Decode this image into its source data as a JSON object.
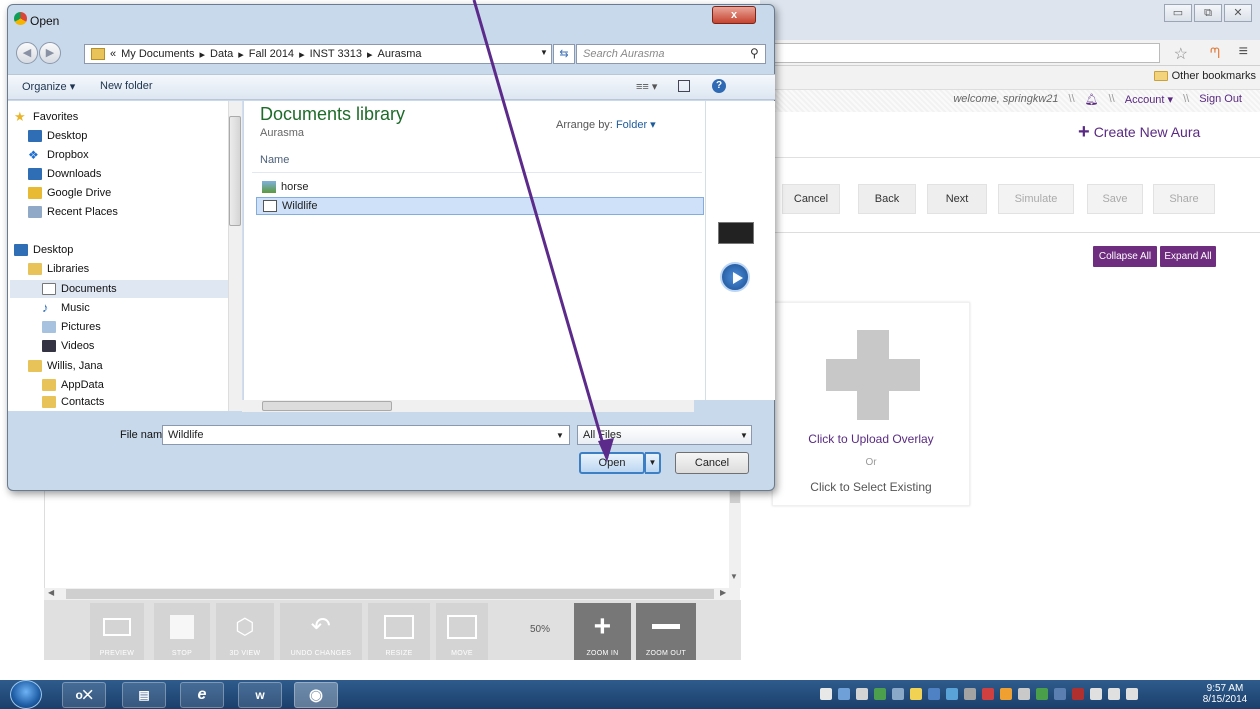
{
  "browser": {
    "win_controls": [
      "▭",
      "⧉",
      "✕"
    ],
    "other_bookmarks": "Other bookmarks"
  },
  "site": {
    "welcome": "welcome, springkw21",
    "sep": "\\\\",
    "account": "Account ▾",
    "signout": "Sign Out",
    "create_aura": "Create New Aura",
    "actions": [
      "Cancel",
      "Back",
      "Next",
      "Simulate",
      "Save",
      "Share"
    ],
    "collapse_all": "Collapse All",
    "expand_all": "Expand All",
    "overlay": {
      "upload": "Click to Upload Overlay",
      "or": "Or",
      "select": "Click to Select Existing"
    },
    "editor_toolbar": {
      "buttons": [
        "PREVIEW",
        "STOP",
        "3D VIEW",
        "UNDO CHANGES",
        "RESIZE",
        "MOVE",
        "ZOOM IN",
        "ZOOM OUT"
      ],
      "zoom_level": "50%"
    }
  },
  "dialog": {
    "title": "Open",
    "close": "x",
    "breadcrumb": [
      "«",
      "My Documents",
      "Data",
      "Fall 2014",
      "INST 3313",
      "Aurasma"
    ],
    "search_placeholder": "Search Aurasma",
    "organize": "Organize ▾",
    "new_folder": "New folder",
    "views": "≡≡ ▾",
    "help": "?",
    "nav": {
      "favorites": "Favorites",
      "desktop": "Desktop",
      "dropbox": "Dropbox",
      "downloads": "Downloads",
      "google_drive": "Google Drive",
      "recent_places": "Recent Places",
      "desktop2": "Desktop",
      "libraries": "Libraries",
      "documents": "Documents",
      "music": "Music",
      "pictures": "Pictures",
      "videos": "Videos",
      "willis": "Willis, Jana",
      "appdata": "AppData",
      "contacts": "Contacts"
    },
    "library": {
      "title": "Documents library",
      "subtitle": "Aurasma",
      "arrange_label": "Arrange by:",
      "arrange_value": "Folder ▾",
      "col_name": "Name",
      "files": [
        "horse",
        "Wildlife"
      ]
    },
    "file_name_label": "File name:",
    "file_name_value": "Wildlife",
    "file_type": "All Files",
    "open": "Open",
    "cancel": "Cancel"
  },
  "taskbar": {
    "apps": [
      "o⨉",
      "▤",
      "e",
      "w",
      "◉"
    ],
    "time": "9:57 AM",
    "date": "8/15/2014"
  },
  "colors": {
    "accent": "#6f2d7f",
    "arrow": "#5b2a8a"
  }
}
